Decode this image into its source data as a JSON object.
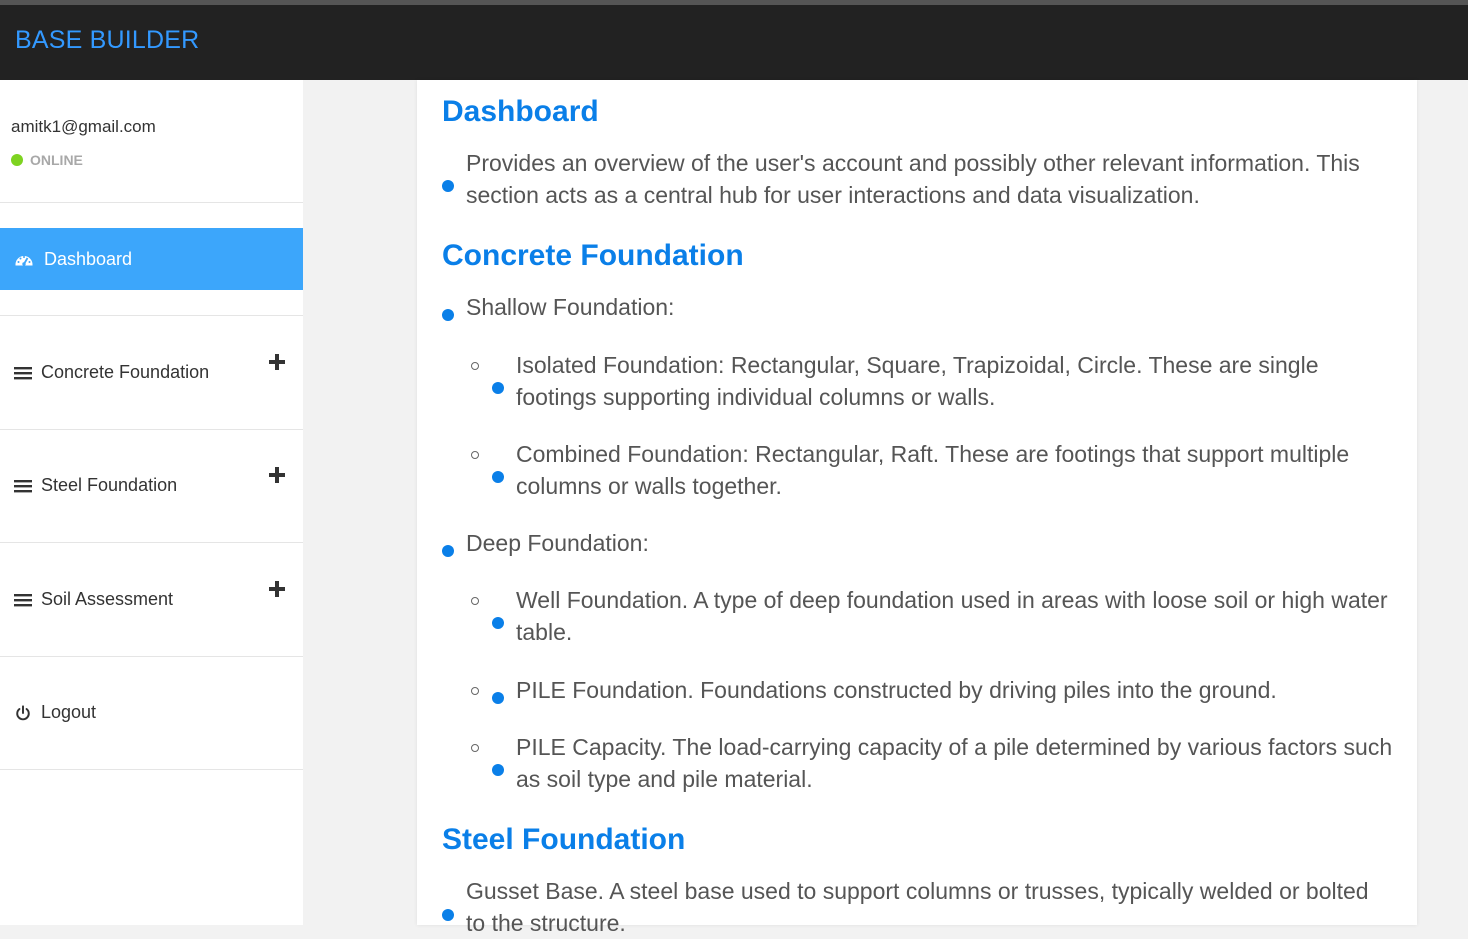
{
  "app": {
    "brand": "BASE BUILDER"
  },
  "user": {
    "email": "amitk1@gmail.com",
    "status": "ONLINE"
  },
  "sidebar": {
    "items": [
      {
        "label": "Dashboard",
        "icon": "dashboard-gauge-icon",
        "active": true
      },
      {
        "label": "Concrete Foundation",
        "icon": "menu-bars-icon",
        "expand_icon": "plus-icon"
      },
      {
        "label": "Steel Foundation",
        "icon": "menu-bars-icon",
        "expand_icon": "plus-icon"
      },
      {
        "label": "Soil Assessment",
        "icon": "menu-bars-icon",
        "expand_icon": "plus-icon"
      },
      {
        "label": "Logout",
        "icon": "power-icon"
      }
    ]
  },
  "content": {
    "dashboard": {
      "title": "Dashboard",
      "items": [
        "Provides an overview of the user's account and possibly other relevant information. This section acts as a central hub for user interactions and data visualization."
      ]
    },
    "concrete": {
      "title": "Concrete Foundation",
      "shallow": "Shallow Foundation:",
      "shallow_items": [
        "Isolated Foundation: Rectangular, Square, Trapizoidal, Circle. These are single footings supporting individual columns or walls.",
        "Combined Foundation: Rectangular, Raft. These are footings that support multiple columns or walls together."
      ],
      "deep": "Deep Foundation:",
      "deep_items": [
        "Well Foundation. A type of deep foundation used in areas with loose soil or high water table.",
        "PILE Foundation. Foundations constructed by driving piles into the ground.",
        "PILE Capacity. The load-carrying capacity of a pile determined by various factors such as soil type and pile material."
      ]
    },
    "steel": {
      "title": "Steel Foundation",
      "items": [
        "Gusset Base. A steel base used to support columns or trusses, typically welded or bolted to the structure."
      ]
    }
  },
  "colors": {
    "navbar": "#222222",
    "brand": "#3399ff",
    "active_menu": "#3ca6fb",
    "heading": "#0a7fe8",
    "online_dot": "#7ed321"
  }
}
